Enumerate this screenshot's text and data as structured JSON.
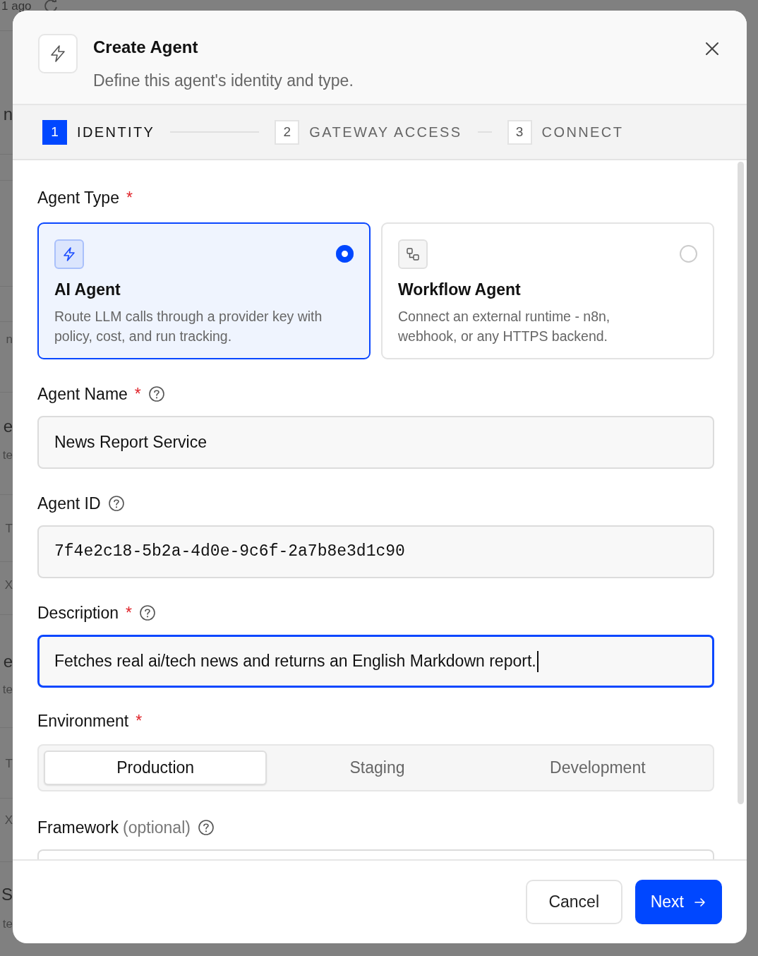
{
  "backdrop": {
    "fragments": [
      {
        "text": "1 ago",
        "kind": "time"
      },
      {
        "text": "n",
        "kind": "title"
      },
      {
        "text": "n",
        "kind": "sub"
      },
      {
        "text": "e",
        "kind": "title"
      },
      {
        "text": "te",
        "kind": "sub"
      },
      {
        "text": "T",
        "kind": "sub"
      },
      {
        "text": "X",
        "kind": "sub"
      },
      {
        "text": "e",
        "kind": "title"
      },
      {
        "text": "te",
        "kind": "sub"
      },
      {
        "text": "T",
        "kind": "sub"
      },
      {
        "text": "X",
        "kind": "sub"
      },
      {
        "text": "S",
        "kind": "title"
      },
      {
        "text": "te",
        "kind": "sub"
      }
    ]
  },
  "dialog": {
    "title": "Create Agent",
    "subtitle": "Define this agent's identity and type."
  },
  "steps": [
    {
      "number": "1",
      "label": "IDENTITY",
      "selected": true
    },
    {
      "number": "2",
      "label": "GATEWAY ACCESS",
      "selected": false
    },
    {
      "number": "3",
      "label": "CONNECT",
      "selected": false
    }
  ],
  "agent_type": {
    "label": "Agent Type",
    "required_mark": "*",
    "options": [
      {
        "kind": "ai",
        "title": "AI Agent",
        "description": "Route LLM calls through a provider key with policy, cost, and run tracking.",
        "selected": true
      },
      {
        "kind": "workflow",
        "title": "Workflow Agent",
        "description": "Connect an external runtime - n8n, webhook, or any HTTPS backend.",
        "selected": false
      }
    ]
  },
  "fields": [
    {
      "label": "Agent Name",
      "required_mark": "*",
      "kind": "text",
      "value": "News Report Service",
      "focused": false
    },
    {
      "label": "Agent ID",
      "kind": "id",
      "value": "7f4e2c18-5b2a-4d0e-9c6f-2a7b8e3d1c90",
      "focused": false
    },
    {
      "label": "Description",
      "required_mark": "*",
      "kind": "text",
      "value": "Fetches real ai/tech news and returns an English Markdown report.",
      "focused": true
    }
  ],
  "environment": {
    "label": "Environment",
    "required_mark": "*",
    "options": [
      {
        "label": "Production",
        "selected": true
      },
      {
        "label": "Staging",
        "selected": false
      },
      {
        "label": "Development",
        "selected": false
      }
    ]
  },
  "framework": {
    "label": "Framework",
    "hint": "(optional)"
  },
  "buttons": [
    {
      "label": "Cancel",
      "kind": "secondary"
    },
    {
      "label": "Next",
      "kind": "primary"
    }
  ]
}
